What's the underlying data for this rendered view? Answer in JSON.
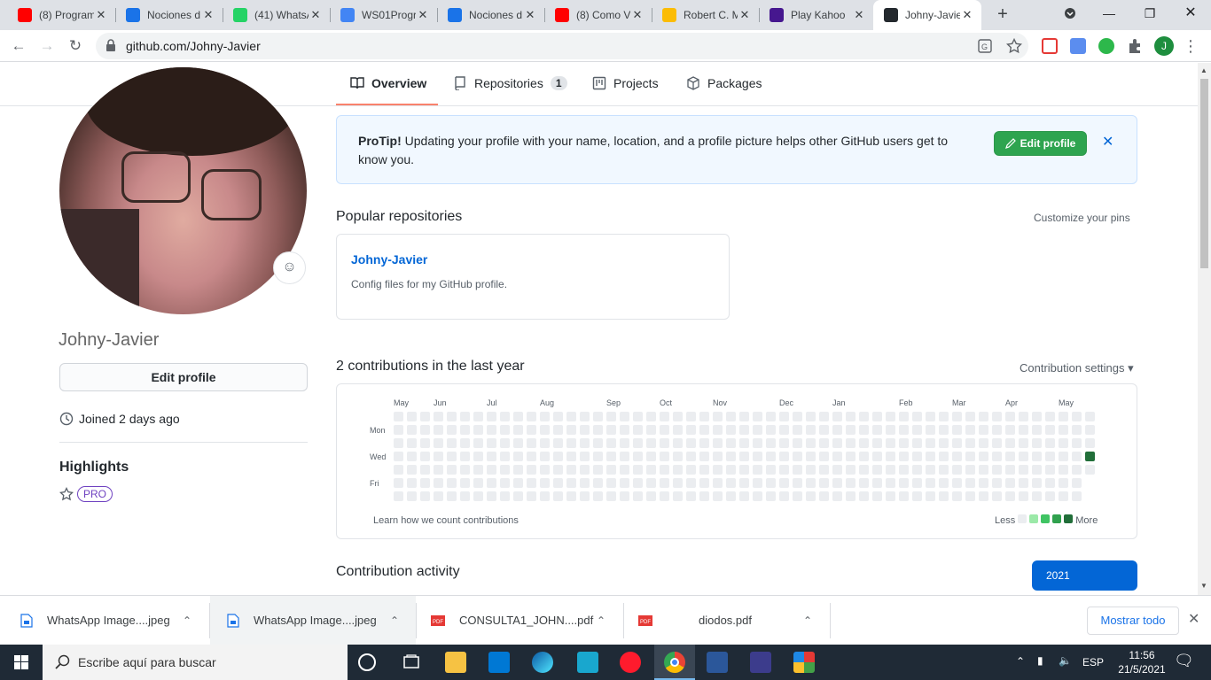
{
  "browser": {
    "tabs": [
      {
        "title": "(8) Program",
        "favicon": "youtube-icon",
        "color": "#ff0000"
      },
      {
        "title": "Nociones d",
        "favicon": "google-classroom-icon",
        "color": "#1a73e8"
      },
      {
        "title": "(41) WhatsA",
        "favicon": "whatsapp-icon",
        "color": "#25d366"
      },
      {
        "title": "WS01Progr",
        "favicon": "google-docs-icon",
        "color": "#4285f4"
      },
      {
        "title": "Nociones d",
        "favicon": "google-classroom-icon",
        "color": "#1a73e8"
      },
      {
        "title": "(8) Como V",
        "favicon": "youtube-icon",
        "color": "#ff0000"
      },
      {
        "title": "Robert C. M",
        "favicon": "google-drive-icon",
        "color": "#fbbc04"
      },
      {
        "title": "Play Kahoo",
        "favicon": "kahoot-icon",
        "color": "#46178f"
      },
      {
        "title": "Johny-Javie",
        "favicon": "github-icon",
        "color": "#24292e"
      }
    ],
    "url": "github.com/Johny-Javier",
    "profile_initial": "J"
  },
  "github": {
    "nav": {
      "overview": "Overview",
      "repositories": "Repositories",
      "repositories_count": "1",
      "projects": "Projects",
      "packages": "Packages"
    },
    "profile": {
      "username": "Johny-Javier",
      "edit_button": "Edit profile",
      "joined": "Joined 2 days ago",
      "highlights_title": "Highlights",
      "pro_badge": "PRO"
    },
    "protip": {
      "label": "ProTip!",
      "text": " Updating your profile with your name, location, and a profile picture helps other GitHub users get to know you.",
      "button": "Edit profile"
    },
    "popular": {
      "title": "Popular repositories",
      "customize": "Customize your pins",
      "repo_name": "Johny-Javier",
      "repo_desc": "Config files for my GitHub profile."
    },
    "contributions": {
      "title": "2 contributions in the last year",
      "settings": "Contribution settings ▾",
      "months": [
        "May",
        "Jun",
        "Jul",
        "Aug",
        "Sep",
        "Oct",
        "Nov",
        "Dec",
        "Jan",
        "Feb",
        "Mar",
        "Apr",
        "May"
      ],
      "days": [
        "Mon",
        "Wed",
        "Fri"
      ],
      "learn": "Learn how we count contributions",
      "less": "Less",
      "more": "More",
      "colors": [
        "#ebedf0",
        "#9be9a8",
        "#40c463",
        "#30a14e",
        "#216e39"
      ]
    },
    "activity": {
      "title": "Contribution activity",
      "year": "2021"
    }
  },
  "downloads": {
    "items": [
      {
        "name": "WhatsApp Image....jpeg",
        "type": "image"
      },
      {
        "name": "WhatsApp Image....jpeg",
        "type": "image"
      },
      {
        "name": "CONSULTA1_JOHN....pdf",
        "type": "pdf"
      },
      {
        "name": "diodos.pdf",
        "type": "pdf"
      }
    ],
    "show_all": "Mostrar todo"
  },
  "taskbar": {
    "search_placeholder": "Escribe aquí para buscar",
    "language": "ESP",
    "time": "11:56",
    "date": "21/5/2021"
  }
}
